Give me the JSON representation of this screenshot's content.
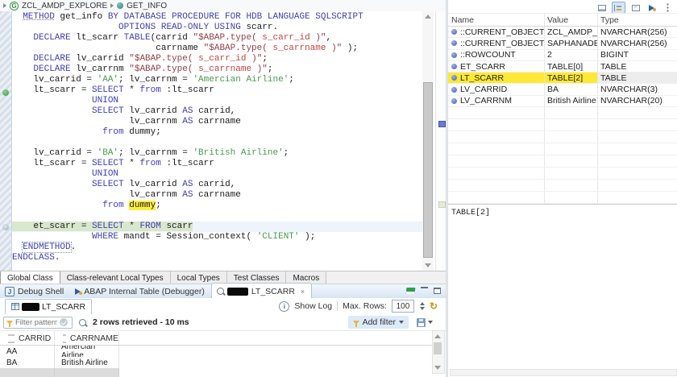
{
  "palette": {
    "keyword_blue": "#3f3fb5",
    "string_green": "#4a9b4f",
    "literal_red": "#c4423e",
    "quote_brown": "#964046",
    "highlight_yellow": "#fde935",
    "occurrence_yellow": "#ffef3e",
    "debug_line_green": "#d9e7cd",
    "tabbar_blue": "#d6e4f3"
  },
  "icons": {
    "breadcrumb": [
      "abap-class-icon",
      "abap-method-icon"
    ],
    "variables_toolbar": [
      "show-details-icon",
      "show-logical-structure-icon",
      "collapse-all-icon",
      "load-configuration-icon",
      "view-menu-icon"
    ],
    "view_controls": [
      "pin-view-icon",
      "minimize-view-icon",
      "maximize-view-icon"
    ],
    "preview": [
      "table-icon",
      "info-icon",
      "refresh-icon",
      "filter-funnel-icon",
      "apply-filter-icon",
      "search-table-icon",
      "save-icon",
      "dropdown-arrow-icon"
    ]
  },
  "breadcrumb": {
    "class_name": "ZCL_AMDP_EXPLORE",
    "method_name": "GET_INFO"
  },
  "editor": {
    "marker_lines": [
      7,
      20
    ],
    "lines": [
      {
        "seg": [
          [
            "  ",
            "p"
          ],
          [
            "METHOD",
            "ku"
          ],
          [
            " get_info ",
            "p"
          ],
          [
            "BY DATABASE PROCEDURE FOR HDB LANGUAGE SQLSCRIPT",
            "k"
          ]
        ]
      },
      {
        "seg": [
          [
            "                    ",
            "p"
          ],
          [
            "OPTIONS READ-ONLY USING",
            "k"
          ],
          [
            " scarr.",
            "p"
          ]
        ]
      },
      {
        "seg": [
          [
            "    ",
            "p"
          ],
          [
            "DECLARE",
            "k"
          ],
          [
            " lt_scarr ",
            "p"
          ],
          [
            "TABLE",
            "k"
          ],
          [
            "(carrid ",
            "p"
          ],
          [
            "\"$ABAP.type( ",
            "d"
          ],
          [
            "s_carr_id",
            "r"
          ],
          [
            " )\"",
            "d"
          ],
          [
            ",",
            "p"
          ]
        ]
      },
      {
        "seg": [
          [
            "                           carrname ",
            "p"
          ],
          [
            "\"$ABAP.type( ",
            "d"
          ],
          [
            "s_carrname",
            "r"
          ],
          [
            " )\"",
            "d"
          ],
          [
            " );",
            "p"
          ]
        ]
      },
      {
        "seg": [
          [
            "    ",
            "p"
          ],
          [
            "DECLARE",
            "k"
          ],
          [
            " lv_carrid ",
            "p"
          ],
          [
            "\"$ABAP.type( ",
            "d"
          ],
          [
            "s_carr_id",
            "r"
          ],
          [
            " )\"",
            "d"
          ],
          [
            ";",
            "p"
          ]
        ]
      },
      {
        "seg": [
          [
            "    ",
            "p"
          ],
          [
            "DECLARE",
            "k"
          ],
          [
            " lv_carrnm ",
            "p"
          ],
          [
            "\"$ABAP.type( ",
            "d"
          ],
          [
            "s_carrname",
            "r"
          ],
          [
            " )\"",
            "d"
          ],
          [
            ";",
            "p"
          ]
        ]
      },
      {
        "seg": [
          [
            "    lv_carrid = ",
            "p"
          ],
          [
            "'AA'",
            "s"
          ],
          [
            "; lv_carrnm = ",
            "p"
          ],
          [
            "'Amercian Airline'",
            "s"
          ],
          [
            ";",
            "p"
          ]
        ]
      },
      {
        "seg": [
          [
            "    lt_scarr = ",
            "p"
          ],
          [
            "SELECT",
            "k"
          ],
          [
            " * ",
            "p"
          ],
          [
            "from",
            "k"
          ],
          [
            " :lt_scarr",
            "p"
          ]
        ]
      },
      {
        "seg": [
          [
            "               ",
            "p"
          ],
          [
            "UNION",
            "k"
          ]
        ]
      },
      {
        "seg": [
          [
            "               ",
            "p"
          ],
          [
            "SELECT",
            "k"
          ],
          [
            " lv_carrid ",
            "p"
          ],
          [
            "AS",
            "k"
          ],
          [
            " carrid,",
            "p"
          ]
        ]
      },
      {
        "seg": [
          [
            "                      lv_carrnm ",
            "p"
          ],
          [
            "AS",
            "k"
          ],
          [
            " carrname",
            "p"
          ]
        ]
      },
      {
        "seg": [
          [
            "                 ",
            "p"
          ],
          [
            "from",
            "k"
          ],
          [
            " dummy;",
            "p"
          ]
        ]
      },
      {
        "seg": [
          [
            "",
            "p"
          ]
        ]
      },
      {
        "seg": [
          [
            "    lv_carrid = ",
            "p"
          ],
          [
            "'BA'",
            "s"
          ],
          [
            "; lv_carrnm = ",
            "p"
          ],
          [
            "'British Airline'",
            "s"
          ],
          [
            ";",
            "p"
          ]
        ]
      },
      {
        "seg": [
          [
            "    lt_scarr = ",
            "p"
          ],
          [
            "SELECT",
            "k"
          ],
          [
            " * ",
            "p"
          ],
          [
            "from",
            "k"
          ],
          [
            " :lt_scarr",
            "p"
          ]
        ]
      },
      {
        "seg": [
          [
            "               ",
            "p"
          ],
          [
            "UNION",
            "k"
          ]
        ]
      },
      {
        "seg": [
          [
            "               ",
            "p"
          ],
          [
            "SELECT",
            "k"
          ],
          [
            " lv_carrid ",
            "p"
          ],
          [
            "AS",
            "k"
          ],
          [
            " carrid,",
            "p"
          ]
        ]
      },
      {
        "seg": [
          [
            "                      lv_carrnm ",
            "p"
          ],
          [
            "AS",
            "k"
          ],
          [
            " carrname",
            "p"
          ]
        ]
      },
      {
        "seg": [
          [
            "                 ",
            "p"
          ],
          [
            "from",
            "k"
          ],
          [
            " ",
            "p"
          ],
          [
            "dummy",
            "y"
          ],
          [
            ";",
            "p"
          ]
        ]
      },
      {
        "seg": [
          [
            "",
            "p"
          ]
        ]
      },
      {
        "hl": true,
        "seg": [
          [
            "    et_scarr = ",
            "p"
          ],
          [
            "SELECT",
            "k"
          ],
          [
            " * ",
            "p"
          ],
          [
            "FROM",
            "k"
          ],
          [
            " scarr",
            "p"
          ]
        ]
      },
      {
        "seg": [
          [
            "               ",
            "p"
          ],
          [
            "WHERE",
            "k"
          ],
          [
            " mandt = Session_context( ",
            "p"
          ],
          [
            "'CLIENT'",
            "s"
          ],
          [
            " );",
            "p"
          ]
        ]
      },
      {
        "seg": [
          [
            "  ",
            "p"
          ],
          [
            "ENDMETHOD",
            "kb"
          ],
          [
            ".",
            "p"
          ]
        ]
      },
      {
        "seg": [
          [
            "ENDCLASS",
            "k"
          ],
          [
            ".",
            "p"
          ]
        ]
      }
    ]
  },
  "editor_tabs": {
    "active": 0,
    "items": [
      "Global Class",
      "Class-relevant Local Types",
      "Local Types",
      "Test Classes",
      "Macros"
    ]
  },
  "view_tabs": {
    "active": 2,
    "items": [
      {
        "label": "Debug Shell",
        "icon": "debug-shell-icon",
        "redacted": false,
        "closable": false
      },
      {
        "label": "ABAP Internal Table (Debugger)",
        "icon": "abap-internal-table-icon",
        "redacted": false,
        "closable": false
      },
      {
        "label": "LT_SCARR",
        "icon": "data-preview-icon",
        "redacted": true,
        "closable": true
      }
    ]
  },
  "variables": {
    "columns": [
      "Name",
      "Value",
      "Type"
    ],
    "selected_index": 4,
    "empty_rows": 9,
    "rows": [
      {
        "name": "::CURRENT_OBJECT_NAME",
        "value": "ZCL_AMDP_EX...",
        "type": "NVARCHAR(256)",
        "highlight": false
      },
      {
        "name": "::CURRENT_OBJECT_SCHEMA",
        "value": "SAPHANADB",
        "type": "NVARCHAR(256)",
        "highlight": false
      },
      {
        "name": "::ROWCOUNT",
        "value": "2",
        "type": "BIGINT",
        "highlight": false
      },
      {
        "name": "ET_SCARR",
        "value": "TABLE[0]",
        "type": "TABLE",
        "highlight": false
      },
      {
        "name": "LT_SCARR",
        "value": "TABLE[2]",
        "type": "TABLE",
        "highlight": true
      },
      {
        "name": "LV_CARRID",
        "value": "BA",
        "type": "NVARCHAR(3)",
        "highlight": false
      },
      {
        "name": "LV_CARRNM",
        "value": "British Airline",
        "type": "NVARCHAR(20)",
        "highlight": false
      }
    ],
    "detail": "TABLE[2]"
  },
  "preview": {
    "subtab_label": "LT_SCARR",
    "show_log": "Show Log",
    "max_rows_label": "Max. Rows:",
    "max_rows_value": "100",
    "filter_placeholder": "Filter pattern",
    "status": "2 rows retrieved - 10 ms",
    "add_filter_label": "Add filter",
    "columns": [
      "CARRID",
      "CARRNAME"
    ],
    "rows": [
      [
        "AA",
        "Amercian Airline"
      ],
      [
        "BA",
        "British Airline"
      ]
    ]
  }
}
